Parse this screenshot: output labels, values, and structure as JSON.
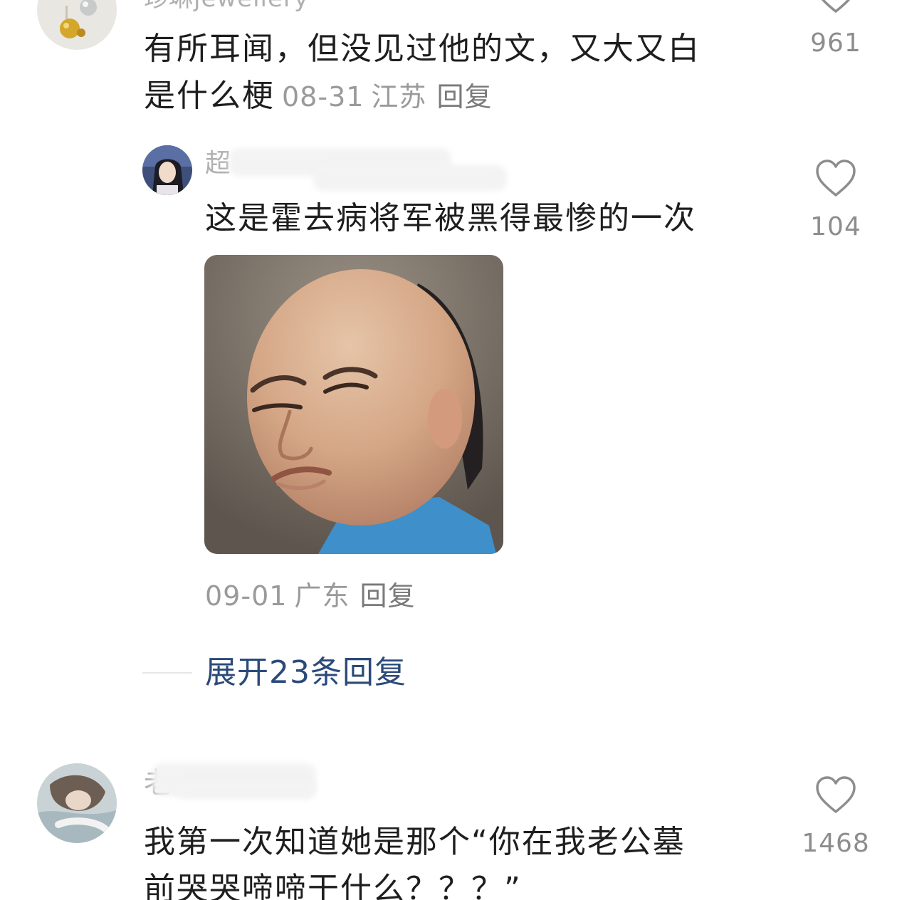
{
  "comments": [
    {
      "username": "珍琳jewellery",
      "text": "有所耳闻，但没见过他的文，又大又白是什么梗",
      "text_line1": "有所耳闻，但没见过他的文，又大又白",
      "text_line2": "是什么梗",
      "date": "08-31",
      "location": "江苏",
      "reply_label": "回复",
      "likes": "961",
      "replies": [
        {
          "username": "超",
          "text": "这是霍去病将军被黑得最惨的一次",
          "date": "09-01",
          "location": "广东",
          "reply_label": "回复",
          "likes": "104"
        }
      ],
      "expand_label": "展开23条回复"
    },
    {
      "username": "老",
      "text_line1": "我第一次知道她是那个“你在我老公墓",
      "text_line2": "前哭哭啼啼干什么？？？”",
      "likes": "1468"
    }
  ],
  "icons": {
    "like": "heart-outline-icon"
  },
  "colors": {
    "text": "#1e1e1e",
    "meta": "#9a9a9a",
    "link": "#2b4a7a",
    "like": "#8d8d8d"
  }
}
